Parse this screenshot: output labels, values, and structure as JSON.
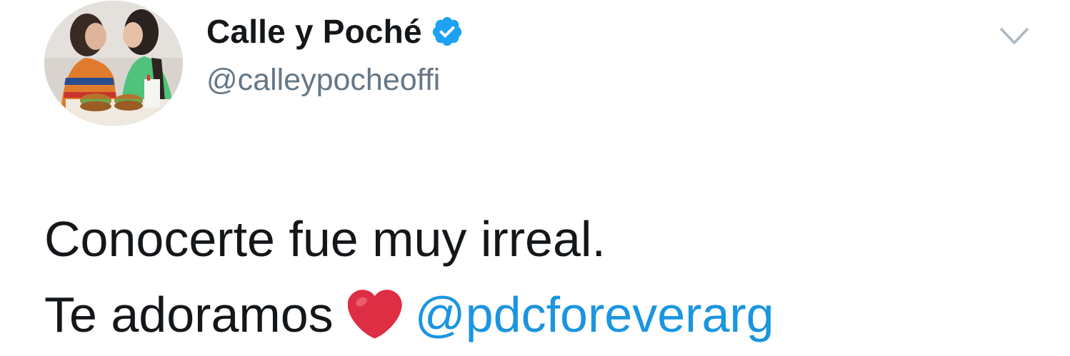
{
  "tweet": {
    "author": {
      "display_name": "Calle y Poché",
      "handle": "@calleypocheoffi",
      "verified_icon": "verified-badge-icon",
      "avatar_icon": "profile-photo"
    },
    "menu_icon": "chevron-down-icon",
    "text_line_1": "Conocerte fue muy irreal.",
    "text_line_2_prefix": "Te adoramos",
    "emoji_icon": "red-heart-emoji",
    "mention": "@pdcforeverarg"
  },
  "colors": {
    "text": "#14171a",
    "handle": "#657786",
    "link": "#1b95e0",
    "verified": "#1da1f2",
    "heart": "#dd2e44",
    "caret": "#aab8c2"
  }
}
